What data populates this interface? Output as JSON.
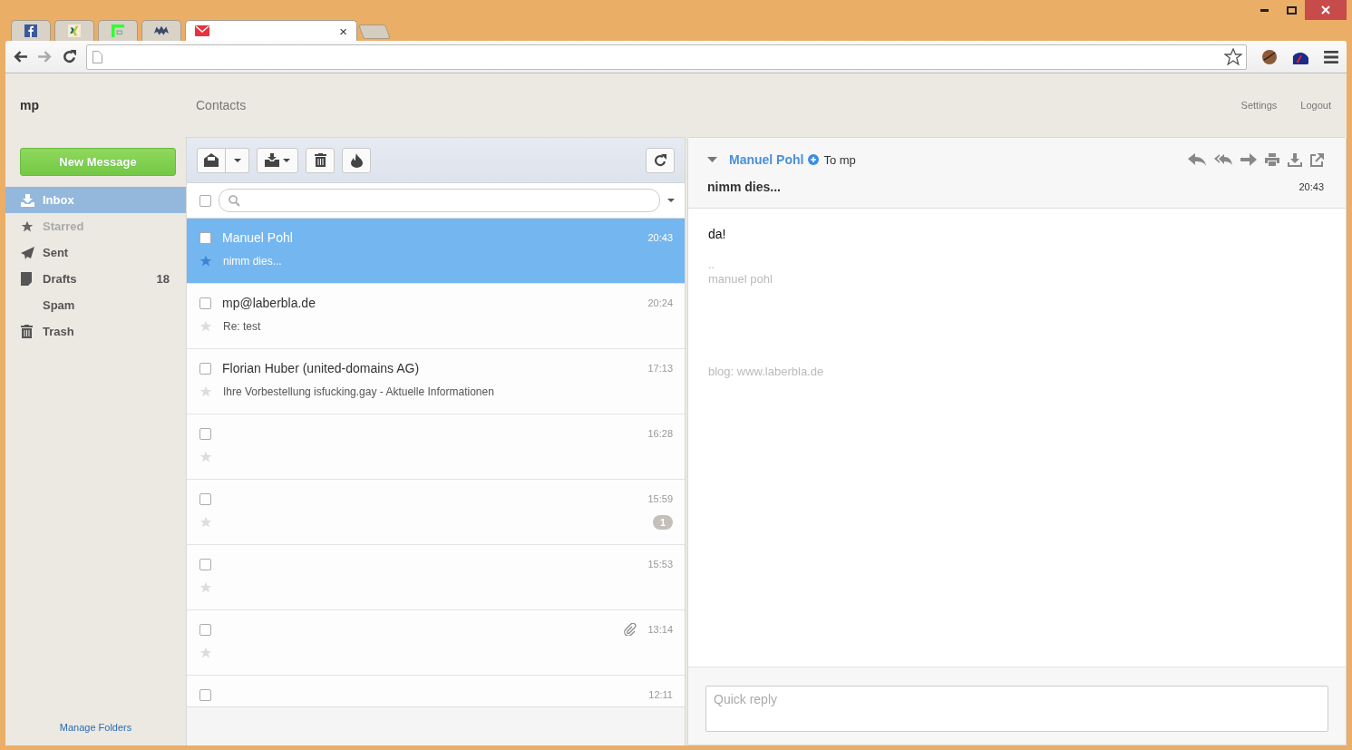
{
  "browser": {
    "tabs": [
      {
        "kind": "facebook",
        "selected": false
      },
      {
        "kind": "xing",
        "selected": false
      },
      {
        "kind": "green",
        "selected": false
      },
      {
        "kind": "bat",
        "selected": false
      },
      {
        "kind": "mail",
        "selected": true,
        "close": "×"
      }
    ]
  },
  "app": {
    "account": "mp",
    "nav": "Contacts",
    "links": [
      "Settings",
      "Logout"
    ]
  },
  "sidebar": {
    "new_message": "New Message",
    "folders": [
      {
        "kind": "inbox",
        "label": "Inbox",
        "selected": true,
        "disabled": false
      },
      {
        "kind": "starred",
        "label": "Starred",
        "selected": false,
        "disabled": true
      },
      {
        "kind": "sent",
        "label": "Sent",
        "selected": false,
        "disabled": false
      },
      {
        "kind": "drafts",
        "label": "Drafts",
        "selected": false,
        "disabled": false,
        "count": "18"
      },
      {
        "kind": "spam",
        "label": "Spam",
        "selected": false,
        "disabled": false
      },
      {
        "kind": "trash",
        "label": "Trash",
        "selected": false,
        "disabled": false
      }
    ],
    "manage": "Manage Folders"
  },
  "message_list": {
    "select_all": {
      "checked": false
    },
    "messages": [
      {
        "from": "Manuel Pohl",
        "subject": "nimm dies...",
        "time": "20:43",
        "selected": true,
        "checked": false
      },
      {
        "from": "mp@laberbla.de",
        "subject": "Re: test",
        "time": "20:24",
        "selected": false,
        "checked": false
      },
      {
        "from": "Florian Huber (united-domains AG)",
        "subject": "Ihre Vorbestellung isfucking.gay - Aktuelle Informationen",
        "time": "17:13",
        "selected": false,
        "checked": false
      },
      {
        "time": "16:28",
        "selected": false,
        "checked": false
      },
      {
        "time": "15:59",
        "selected": false,
        "checked": false,
        "badge": "1"
      },
      {
        "time": "15:53",
        "selected": false,
        "checked": false
      },
      {
        "time": "13:14",
        "selected": false,
        "checked": false,
        "attachment": true
      },
      {
        "time": "12:11",
        "selected": false,
        "checked": false
      }
    ]
  },
  "reader": {
    "from": "Manuel Pohl",
    "to": "To mp",
    "subject": "nimm dies...",
    "time": "20:43",
    "body": "da!",
    "signature": [
      "..",
      "manuel pohl"
    ],
    "blog": "blog: www.laberbla.de"
  },
  "quick_reply": {
    "placeholder": "Quick reply"
  }
}
